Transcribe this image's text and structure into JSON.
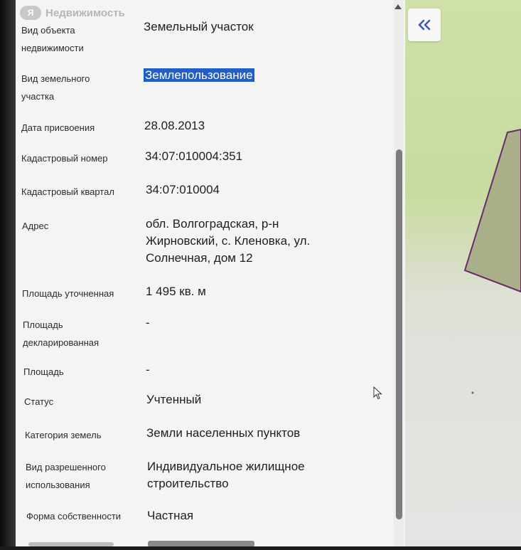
{
  "watermark": {
    "logo_text": "Я",
    "text": "Недвижимость"
  },
  "panel": {
    "fields": [
      {
        "label_lines": [
          "Вид объекта",
          "недвижимости"
        ],
        "value_lines": [
          "Земельный участок"
        ]
      },
      {
        "label_lines": [
          "Вид земельного",
          "участка"
        ],
        "value_lines": [
          "Землепользование"
        ],
        "selected": true
      },
      {
        "label_lines": [
          "Дата присвоения"
        ],
        "value_lines": [
          "28.08.2013"
        ]
      },
      {
        "label_lines": [
          "Кадастровый номер"
        ],
        "value_lines": [
          "34:07:010004:351"
        ]
      },
      {
        "label_lines": [
          "Кадастровый квартал"
        ],
        "value_lines": [
          "34:07:010004"
        ]
      },
      {
        "label_lines": [
          "Адрес"
        ],
        "value_lines": [
          "обл. Волгоградская, р-н",
          "Жирновский, с. Кленовка, ул.",
          "Солнечная, дом 12"
        ]
      },
      {
        "label_lines": [
          "Площадь уточненная"
        ],
        "value_lines": [
          "1 495 кв. м"
        ]
      },
      {
        "label_lines": [
          "Площадь",
          "декларированная"
        ],
        "value_lines": [
          "-"
        ]
      },
      {
        "label_lines": [
          "Площадь"
        ],
        "value_lines": [
          "-"
        ]
      },
      {
        "label_lines": [
          "Статус"
        ],
        "value_lines": [
          "Учтенный"
        ]
      },
      {
        "label_lines": [
          "Категория земель"
        ],
        "value_lines": [
          "Земли населенных пунктов"
        ]
      },
      {
        "label_lines": [
          "Вид разрешенного",
          "использования"
        ],
        "value_lines": [
          "Индивидуальное жилищное",
          "строительство"
        ]
      },
      {
        "label_lines": [
          "Форма собственности"
        ],
        "value_lines": [
          "Частная"
        ]
      }
    ]
  },
  "map_panel": {
    "collapse_icon": "double-chevron-left-icon",
    "accent": "#3b5bb5"
  },
  "colors": {
    "selection": "#1f5fc7",
    "map_green": "#c8db9f",
    "parcel_border": "#6a2a6a"
  }
}
